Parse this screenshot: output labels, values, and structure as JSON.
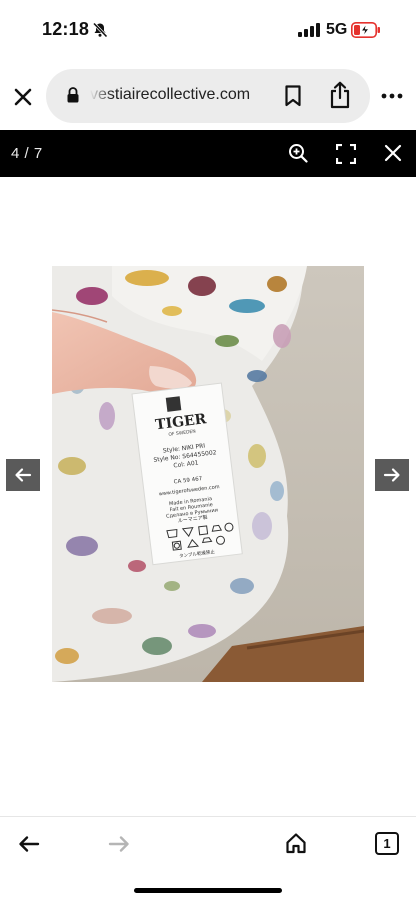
{
  "status_bar": {
    "time": "12:18",
    "network": "5G"
  },
  "browser": {
    "url": "vestiairecollective.com"
  },
  "viewer": {
    "counter": "4 / 7"
  },
  "photo": {
    "label": {
      "brand": "TIGER",
      "brand_sub": "OF SWEDEN",
      "style_line": "Style: NIKI PRI",
      "style_no": "Style No: S64455002",
      "col": "Col: A01",
      "ca": "CA 59 467",
      "website": "www.tigerofsweden.com",
      "made_in_1": "Made in Romania",
      "made_in_2": "Fait en Roumanie",
      "made_in_3": "Сделано в Румынии",
      "made_in_4": "ルーマニア製",
      "footer": "タンブル乾燥禁止"
    }
  },
  "toolbar": {
    "tabs_count": "1"
  },
  "colors": {
    "viewer_bar": "#000000",
    "nav_arrow_bg": "#5a5a5a",
    "url_bar_bg": "#ececec",
    "battery_red": "#e5322d"
  }
}
